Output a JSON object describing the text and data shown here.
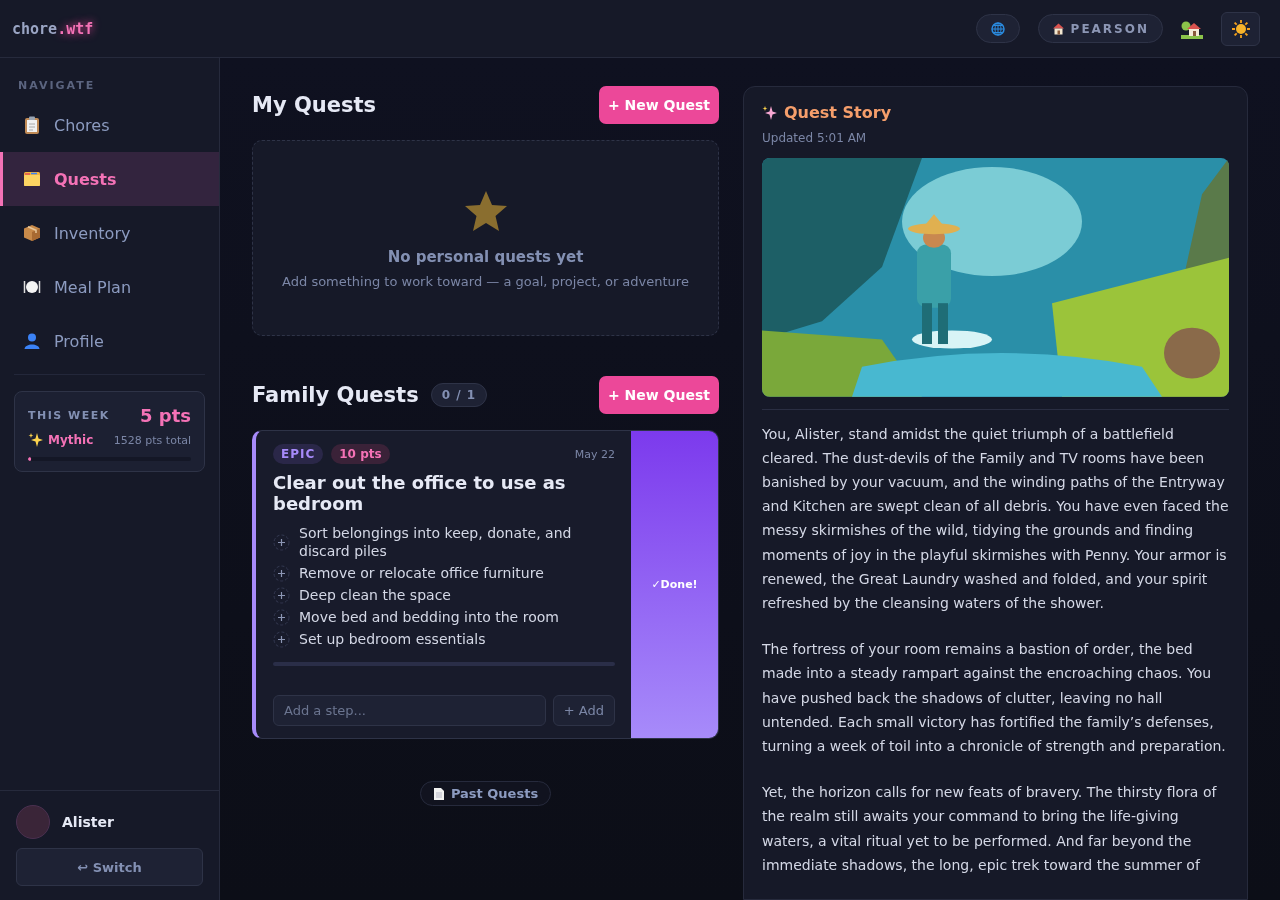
{
  "header": {
    "logo": {
      "main": "chore",
      "accent": ".wtf"
    },
    "household": "PEARSON"
  },
  "sidebar": {
    "section_label": "NAVIGATE",
    "items": [
      {
        "label": "Chores",
        "selected": false
      },
      {
        "label": "Quests",
        "selected": true
      },
      {
        "label": "Inventory",
        "selected": false
      },
      {
        "label": "Meal Plan",
        "selected": false
      },
      {
        "label": "Profile",
        "selected": false
      }
    ],
    "week": {
      "label": "THIS WEEK",
      "points": "5 pts",
      "rank": "Mythic",
      "total": "1528 pts total",
      "level": 0.01
    },
    "user": {
      "name": "Alister",
      "switch_label": "↩ Switch"
    }
  },
  "my_quests": {
    "title": "My Quests",
    "new_button": "+ New Quest",
    "empty_title": "No personal quests yet",
    "empty_text": "Add something to work toward — a goal, project, or adventure"
  },
  "family_quests": {
    "title": "Family Quests",
    "count": "0 / 1",
    "new_button": "+ New Quest",
    "quests": [
      {
        "tier": "EPIC",
        "points": "10 pts",
        "date": "May 22",
        "title": "Clear out the office to use as bedroom",
        "steps": [
          {
            "text": "Sort belongings into keep, donate, and discard piles",
            "checked": false
          },
          {
            "text": "Remove or relocate office furniture",
            "checked": false
          },
          {
            "text": "Deep clean the space",
            "checked": false
          },
          {
            "text": "Move bed and bedding into the room",
            "checked": false
          },
          {
            "text": "Set up bedroom essentials",
            "checked": false
          }
        ],
        "step_placeholder": "Add a step...",
        "add_button": "+ Add",
        "done_button": "✓Done!"
      }
    ],
    "past_button": "Past Quests"
  },
  "story": {
    "title": "Quest Story",
    "updated": "Updated 5:01 AM",
    "paragraphs": [
      "You, Alister, stand amidst the quiet triumph of a battlefield cleared. The dust-devils of the Family and TV rooms have been banished by your vacuum, and the winding paths of the Entryway and Kitchen are swept clean of all debris. You have even faced the messy skirmishes of the wild, tidying the grounds and finding moments of joy in the playful skirmishes with Penny. Your armor is renewed, the Great Laundry washed and folded, and your spirit refreshed by the cleansing waters of the shower.",
      "The fortress of your room remains a bastion of order, the bed made into a steady rampart against the encroaching chaos. You have pushed back the shadows of clutter, leaving no hall untended. Each small victory has fortified the family’s defenses, turning a week of toil into a chronicle of strength and preparation.",
      "Yet, the horizon calls for new feats of bravery. The thirsty flora of the realm still awaits your command to bring the life-giving waters, a vital ritual yet to be performed. And far beyond the immediate shadows, the long, epic trek toward the summer of"
    ]
  }
}
